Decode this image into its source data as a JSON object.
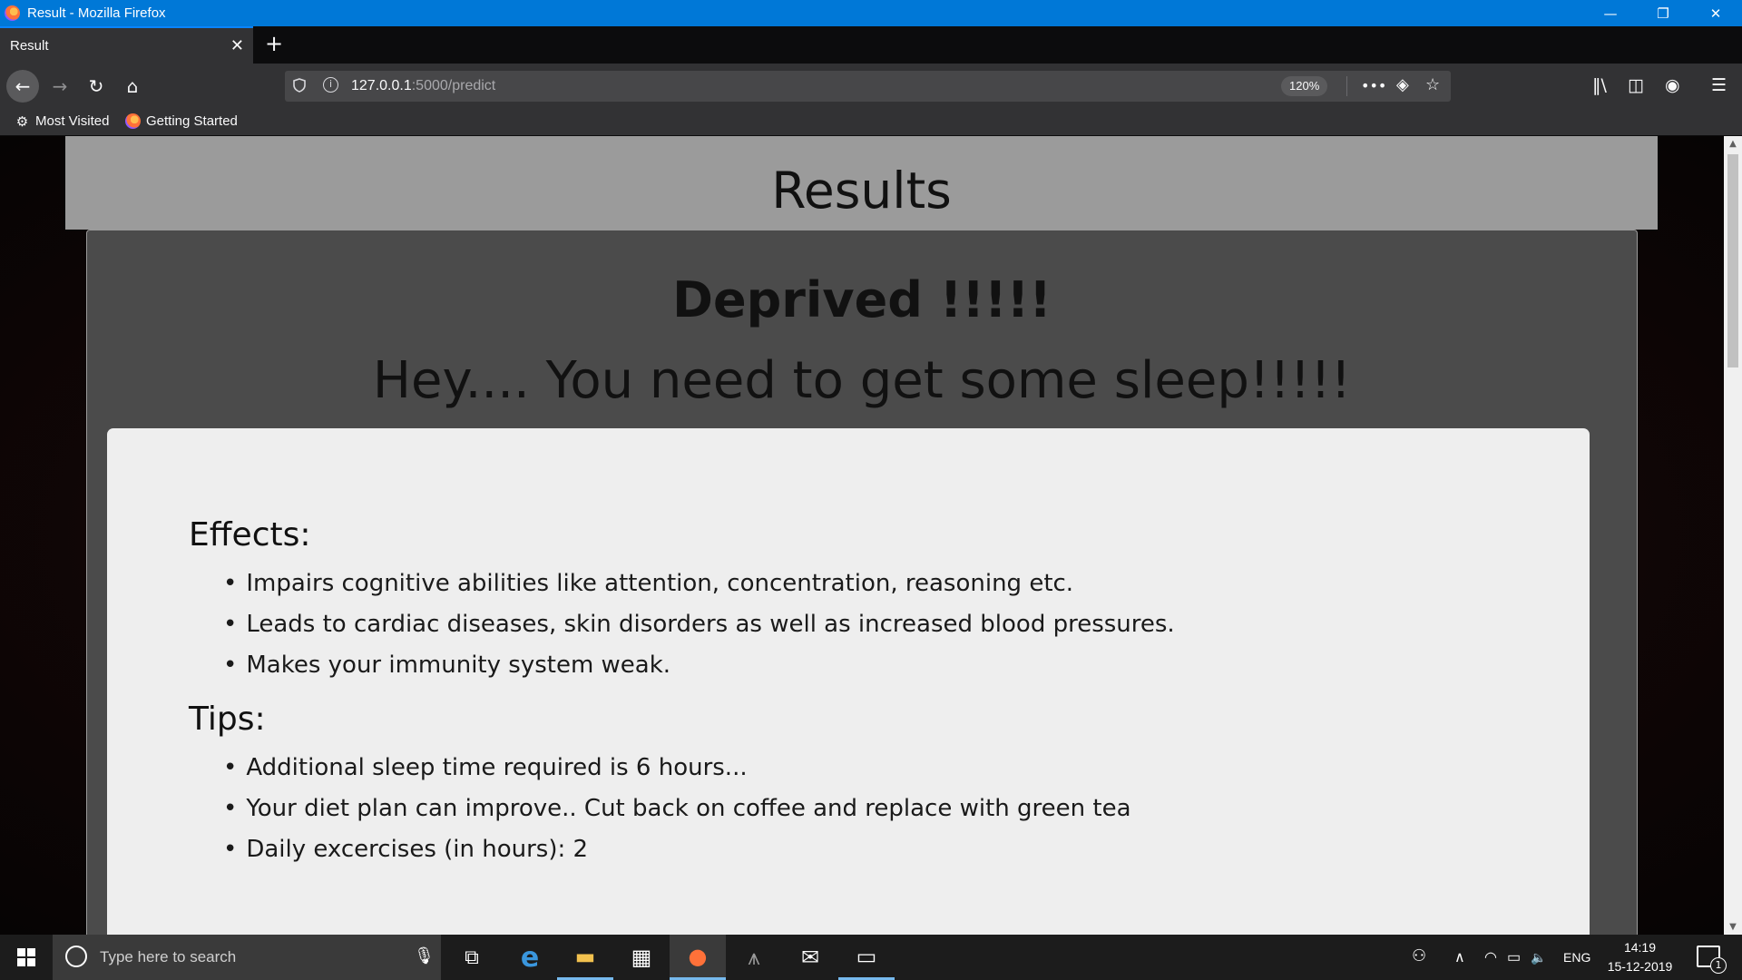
{
  "window": {
    "title": "Result - Mozilla Firefox",
    "minimize": "—",
    "restore": "❐",
    "close": "✕"
  },
  "tabs": [
    {
      "label": "Result",
      "close": "✕",
      "active": true
    }
  ],
  "toolbar": {
    "new_tab": "+",
    "back": "←",
    "forward": "→",
    "reload": "↻",
    "home": "⌂",
    "url_host": "127.0.0.1",
    "url_path": ":5000/predict",
    "zoom": "120%",
    "page_actions": "•••",
    "pocket": "◈",
    "bookmark_star": "☆",
    "library": "‖\\",
    "sidebar": "◫",
    "account": "◉",
    "menu": "☰"
  },
  "bookmarks": [
    {
      "label": "Most Visited",
      "icon": "gear-icon"
    },
    {
      "label": "Getting Started",
      "icon": "firefox-icon"
    }
  ],
  "page": {
    "header": "Results",
    "status": "Deprived !!!!!",
    "message": "Hey.... You need to get some sleep!!!!!",
    "effects_title": "Effects:",
    "effects": [
      "Impairs cognitive abilities like attention, concentration, reasoning etc.",
      "Leads to cardiac diseases, skin disorders as well as increased blood pressures.",
      "Makes your immunity system weak."
    ],
    "tips_title": "Tips:",
    "tips": [
      "Additional sleep time required is 6 hours...",
      "Your diet plan can improve.. Cut back on coffee and replace with green tea",
      "Daily excercises (in hours): 2"
    ]
  },
  "scrollbar": {
    "up": "▲",
    "down": "▼"
  },
  "taskbar": {
    "search_placeholder": "Type here to search",
    "mic": "🎙",
    "apps": [
      {
        "name": "task-view",
        "glyph": "⧉"
      },
      {
        "name": "edge",
        "glyph": "e"
      },
      {
        "name": "file-explorer",
        "glyph": "▬"
      },
      {
        "name": "store",
        "glyph": "▦"
      },
      {
        "name": "firefox",
        "glyph": "●"
      },
      {
        "name": "predator",
        "glyph": "⩚"
      },
      {
        "name": "mail",
        "glyph": "✉"
      },
      {
        "name": "terminal",
        "glyph": "▭"
      }
    ],
    "tray": {
      "people": "⚇",
      "chevron": "∧",
      "wifi": "◠",
      "battery": "▭",
      "volume": "🔈",
      "language": "ENG"
    },
    "time": "14:19",
    "date": "15-12-2019",
    "notifications": "1"
  },
  "colors": {
    "titlebar": "#0078d7",
    "header_band": "#9b9b9b",
    "panel": "#4b4b4b",
    "card": "#eeeeee"
  }
}
